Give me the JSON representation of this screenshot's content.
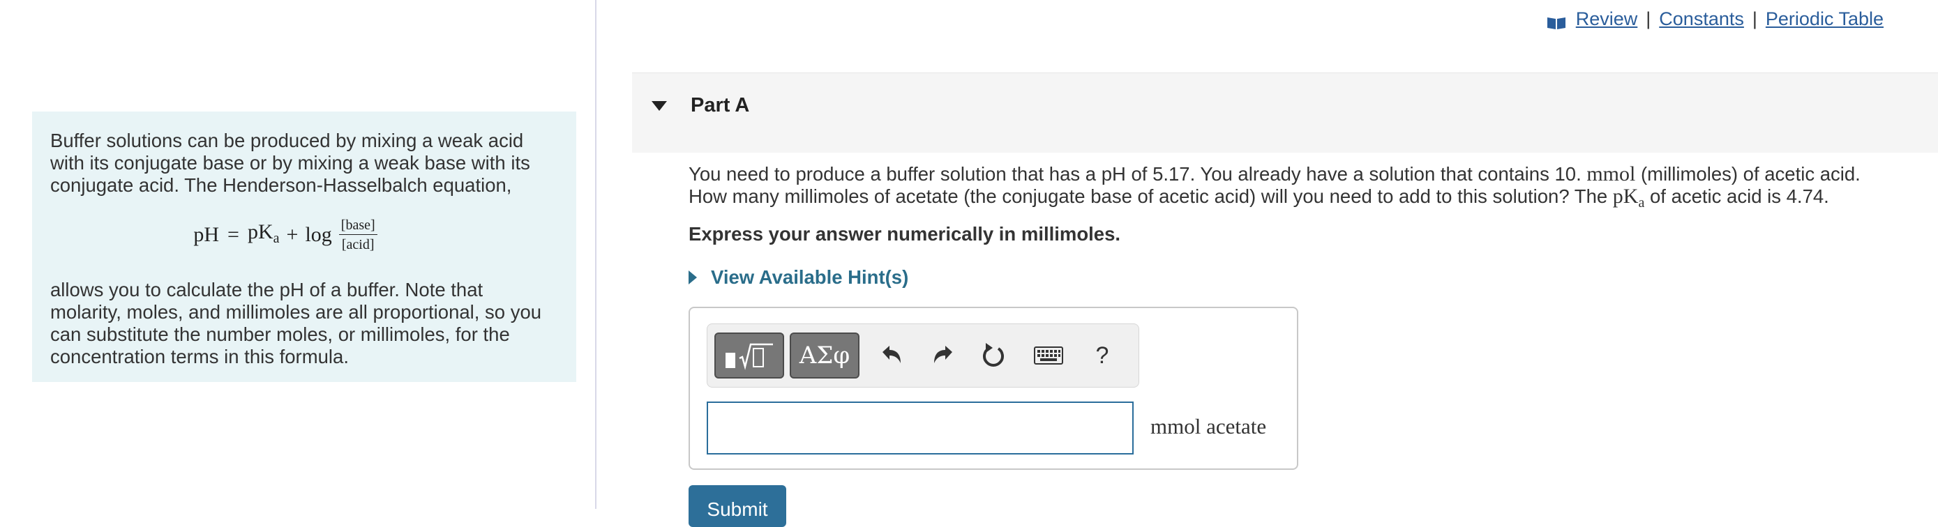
{
  "header": {
    "links": [
      "Review",
      "Constants",
      "Periodic Table"
    ],
    "separator": "|"
  },
  "intro": {
    "paragraph1": "Buffer solutions can be produced by mixing a weak acid with its conjugate base or by mixing a weak base with its conjugate acid. The Henderson-Hasselbalch equation,",
    "formula": {
      "lhs": "pH",
      "equals": "=",
      "pka": "pK",
      "pka_sub": "a",
      "plus": "+",
      "log": "log",
      "numerator": "[base]",
      "denominator": "[acid]"
    },
    "paragraph2": "allows you to calculate the pH of a buffer. Note that molarity, moles, and millimoles are all proportional, so you can substitute the number moles, or millimoles, for the concentration terms in this formula."
  },
  "part": {
    "title": "Part A",
    "question_pre": "You need to produce a buffer solution that has a pH of 5.17. You already have a solution that contains 10. ",
    "question_unit": "mmol",
    "question_mid": " (millimoles) of acetic acid. How many millimoles of acetate (the conjugate base of acetic acid) will you need to add to this solution? The ",
    "question_pka": "pK",
    "question_pka_sub": "a",
    "question_post": " of acetic acid is 4.74.",
    "instruction": "Express your answer numerically in millimoles.",
    "hints_label": "View Available Hint(s)"
  },
  "answer": {
    "toolbar": {
      "symbols_label": "ΑΣφ",
      "help_label": "?"
    },
    "input_value": "",
    "units": "mmol acetate",
    "submit_label": "Submit"
  },
  "colors": {
    "link": "#2a5d9b",
    "intro_bg": "#e8f4f6",
    "submit_bg": "#2d6f99",
    "hint": "#2a6d8a"
  },
  "icons": [
    "book-icon",
    "templates-icon",
    "undo-icon",
    "redo-icon",
    "reset-icon",
    "keyboard-icon"
  ]
}
